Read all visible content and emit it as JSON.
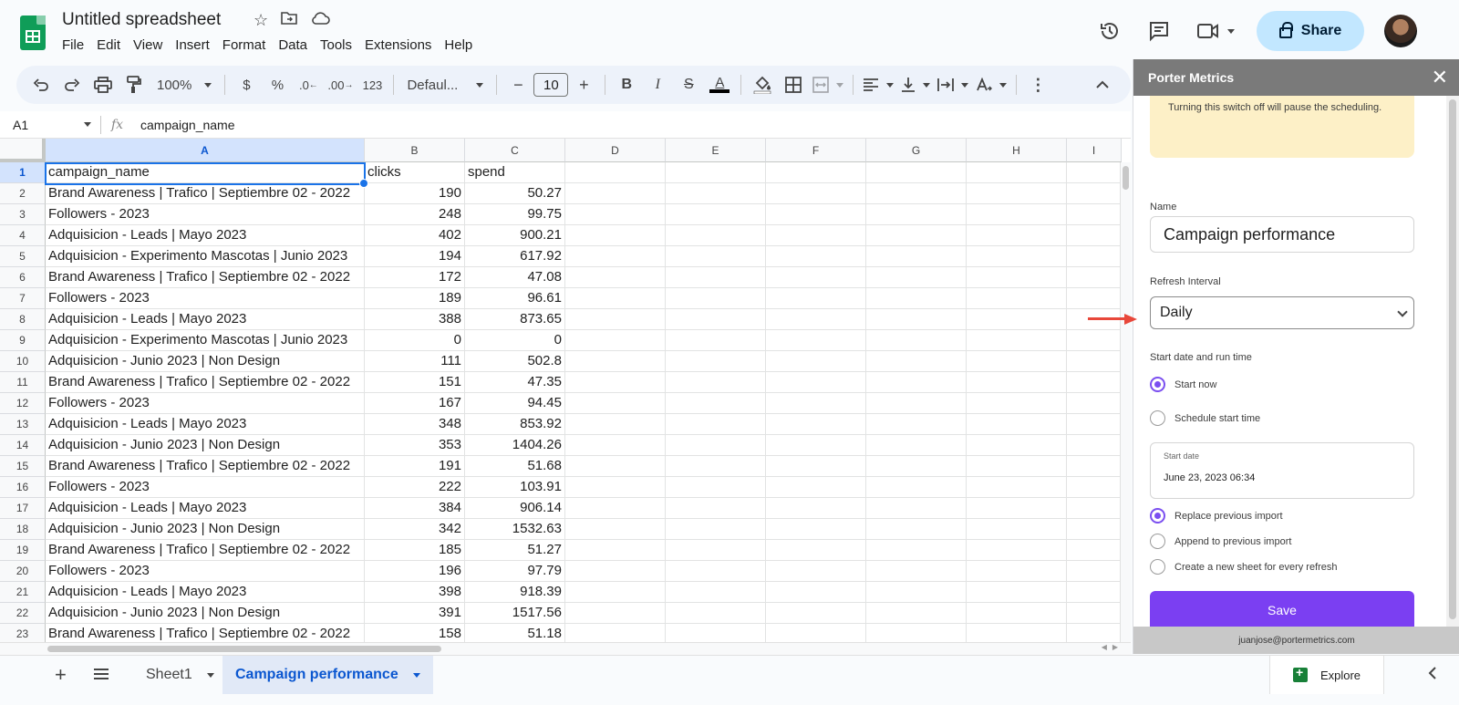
{
  "app": {
    "title": "Untitled spreadsheet",
    "menu": [
      "File",
      "Edit",
      "View",
      "Insert",
      "Format",
      "Data",
      "Tools",
      "Extensions",
      "Help"
    ],
    "share_label": "Share"
  },
  "toolbar": {
    "zoom": "100%",
    "currency": "$",
    "percent": "%",
    "dec_decrease": ".0",
    "dec_increase": ".00",
    "more_formats": "123",
    "font": "Defaul...",
    "font_size": "10",
    "minus": "−",
    "plus": "+",
    "bold": "B",
    "italic": "I",
    "strike": "S",
    "textcolor": "A",
    "more": "⋮"
  },
  "formula_bar": {
    "cell_ref": "A1",
    "fx": "fx",
    "content": "campaign_name"
  },
  "sheet": {
    "columns": [
      "A",
      "B",
      "C",
      "D",
      "E",
      "F",
      "G",
      "H",
      "I"
    ],
    "row_numbers": [
      "1",
      "2",
      "3",
      "4",
      "5",
      "6",
      "7",
      "8",
      "9",
      "10",
      "11",
      "12",
      "13",
      "14",
      "15",
      "16",
      "17",
      "18",
      "19",
      "20",
      "21",
      "22",
      "23"
    ],
    "rows": [
      [
        "campaign_name",
        "clicks",
        "spend"
      ],
      [
        "Brand Awareness | Trafico | Septiembre 02 - 2022",
        "190",
        "50.27"
      ],
      [
        "Followers - 2023",
        "248",
        "99.75"
      ],
      [
        "Adquisicion - Leads | Mayo 2023",
        "402",
        "900.21"
      ],
      [
        "Adquisicion - Experimento Mascotas | Junio 2023",
        "194",
        "617.92"
      ],
      [
        "Brand Awareness | Trafico | Septiembre 02 - 2022",
        "172",
        "47.08"
      ],
      [
        "Followers - 2023",
        "189",
        "96.61"
      ],
      [
        "Adquisicion - Leads | Mayo 2023",
        "388",
        "873.65"
      ],
      [
        "Adquisicion - Experimento Mascotas | Junio 2023",
        "0",
        "0"
      ],
      [
        "Adquisicion - Junio 2023 | Non Design",
        "111",
        "502.8"
      ],
      [
        "Brand Awareness | Trafico | Septiembre 02 - 2022",
        "151",
        "47.35"
      ],
      [
        "Followers - 2023",
        "167",
        "94.45"
      ],
      [
        "Adquisicion - Leads | Mayo 2023",
        "348",
        "853.92"
      ],
      [
        "Adquisicion - Junio 2023 | Non Design",
        "353",
        "1404.26"
      ],
      [
        "Brand Awareness | Trafico | Septiembre 02 - 2022",
        "191",
        "51.68"
      ],
      [
        "Followers - 2023",
        "222",
        "103.91"
      ],
      [
        "Adquisicion - Leads | Mayo 2023",
        "384",
        "906.14"
      ],
      [
        "Adquisicion - Junio 2023 | Non Design",
        "342",
        "1532.63"
      ],
      [
        "Brand Awareness | Trafico | Septiembre 02 - 2022",
        "185",
        "51.27"
      ],
      [
        "Followers - 2023",
        "196",
        "97.79"
      ],
      [
        "Adquisicion - Leads | Mayo 2023",
        "398",
        "918.39"
      ],
      [
        "Adquisicion - Junio 2023 | Non Design",
        "391",
        "1517.56"
      ],
      [
        "Brand Awareness | Trafico | Septiembre 02 - 2022",
        "158",
        "51.18"
      ]
    ]
  },
  "tabs": {
    "sheets": [
      "Sheet1",
      "Campaign performance"
    ],
    "active": "Campaign performance",
    "explore_label": "Explore"
  },
  "panel": {
    "title": "Porter Metrics",
    "notice": "Turning this switch off will pause the scheduling.",
    "name_label": "Name",
    "name_value": "Campaign performance",
    "refresh_label": "Refresh Interval",
    "refresh_value": "Daily",
    "start_label": "Start date and run time",
    "start_options": [
      "Start now",
      "Schedule start time"
    ],
    "start_selected": "Start now",
    "date_label": "Start date",
    "date_value": "June 23, 2023 06:34",
    "import_options": [
      "Replace previous import",
      "Append to previous import",
      "Create a new sheet for every refresh"
    ],
    "import_selected": "Replace previous import",
    "save_label": "Save",
    "footer_email": "juanjose@portermetrics.com"
  },
  "colors": {
    "accent_purple": "#7b3ff2",
    "share_bg": "#c2e7ff",
    "selection_blue": "#1a73e8",
    "notice_bg": "#fdf0c7",
    "arrow_red": "#e8473a"
  }
}
